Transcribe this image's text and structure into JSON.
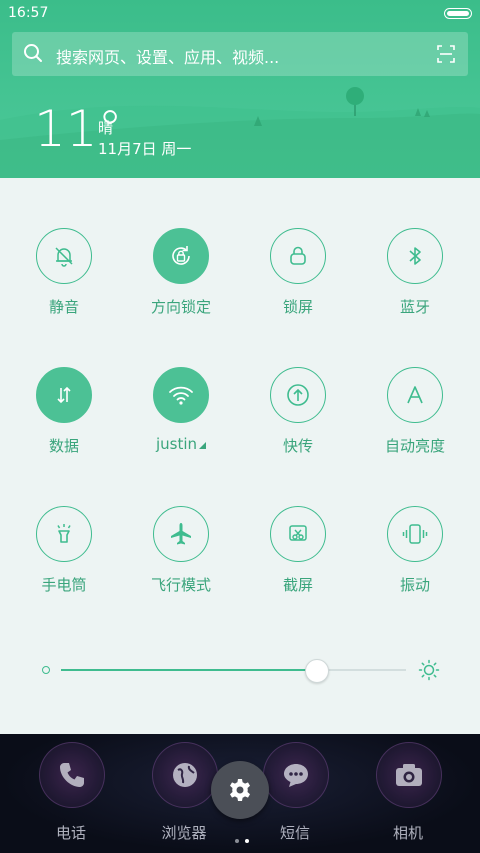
{
  "status_bar": {
    "time": "16:57",
    "battery_level": 1.0
  },
  "search": {
    "placeholder": "搜索网页、设置、应用、视频..."
  },
  "weather": {
    "temperature": "11°",
    "condition": "晴",
    "date": "11月7日 周一"
  },
  "toggles": [
    {
      "label": "静音",
      "icon": "bell-off-icon",
      "active": false
    },
    {
      "label": "方向锁定",
      "icon": "rotation-lock-icon",
      "active": true
    },
    {
      "label": "锁屏",
      "icon": "lock-icon",
      "active": false
    },
    {
      "label": "蓝牙",
      "icon": "bluetooth-icon",
      "active": false
    },
    {
      "label": "数据",
      "icon": "mobile-data-icon",
      "active": true
    },
    {
      "label": "justin",
      "icon": "wifi-icon",
      "active": true
    },
    {
      "label": "快传",
      "icon": "upload-icon",
      "active": false
    },
    {
      "label": "自动亮度",
      "icon": "auto-brightness-icon",
      "active": false
    },
    {
      "label": "手电筒",
      "icon": "flashlight-icon",
      "active": false
    },
    {
      "label": "飞行模式",
      "icon": "airplane-icon",
      "active": false
    },
    {
      "label": "截屏",
      "icon": "screenshot-icon",
      "active": false
    },
    {
      "label": "振动",
      "icon": "vibrate-icon",
      "active": false
    }
  ],
  "brightness": {
    "level": 0.74
  },
  "dock": {
    "apps": [
      {
        "label": "电话",
        "icon": "phone-icon"
      },
      {
        "label": "浏览器",
        "icon": "browser-icon"
      },
      {
        "label": "短信",
        "icon": "message-icon"
      },
      {
        "label": "相机",
        "icon": "camera-icon"
      }
    ],
    "page_count": 2,
    "current_page": 1
  },
  "colors": {
    "accent": "#4cc195",
    "header": "#45c493",
    "panel": "#edf4f3"
  }
}
